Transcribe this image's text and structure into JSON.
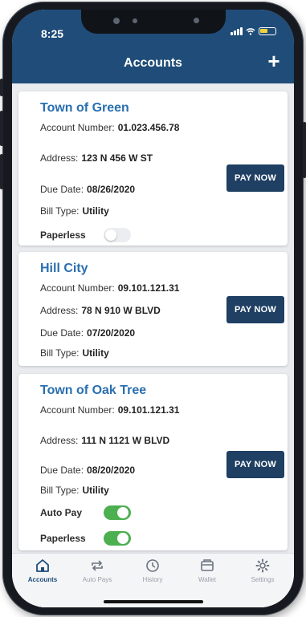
{
  "status_bar": {
    "time": "8:25"
  },
  "header": {
    "title": "Accounts",
    "add_label": "+"
  },
  "labels": {
    "account_number": "Account Number:",
    "address": "Address:",
    "due_date": "Due Date:",
    "bill_type": "Bill Type:",
    "paperless": "Paperless",
    "auto_pay": "Auto Pay",
    "pay_now": "PAY NOW"
  },
  "accounts": [
    {
      "name": "Town of Green",
      "account_number": "01.023.456.78",
      "address": "123 N 456 W ST",
      "due_date": "08/26/2020",
      "bill_type": "Utility",
      "paperless": false
    },
    {
      "name": "Hill City",
      "account_number": "09.101.121.31",
      "address": "78 N 910 W BLVD",
      "due_date": "07/20/2020",
      "bill_type": "Utility"
    },
    {
      "name": "Town of Oak Tree",
      "account_number": "09.101.121.31",
      "address": "111 N 1121 W BLVD",
      "due_date": "08/20/2020",
      "bill_type": "Utility",
      "auto_pay": true,
      "paperless": true
    }
  ],
  "tabs": [
    {
      "label": "Accounts",
      "icon": "home-icon",
      "active": true
    },
    {
      "label": "Auto Pays",
      "icon": "repeat-icon",
      "active": false
    },
    {
      "label": "History",
      "icon": "clock-icon",
      "active": false
    },
    {
      "label": "Wallet",
      "icon": "wallet-icon",
      "active": false
    },
    {
      "label": "Settings",
      "icon": "gear-icon",
      "active": false
    }
  ],
  "colors": {
    "header": "#1f4c78",
    "title": "#2a6fb0",
    "button": "#1f3f63",
    "toggle_on": "#4caf50"
  }
}
